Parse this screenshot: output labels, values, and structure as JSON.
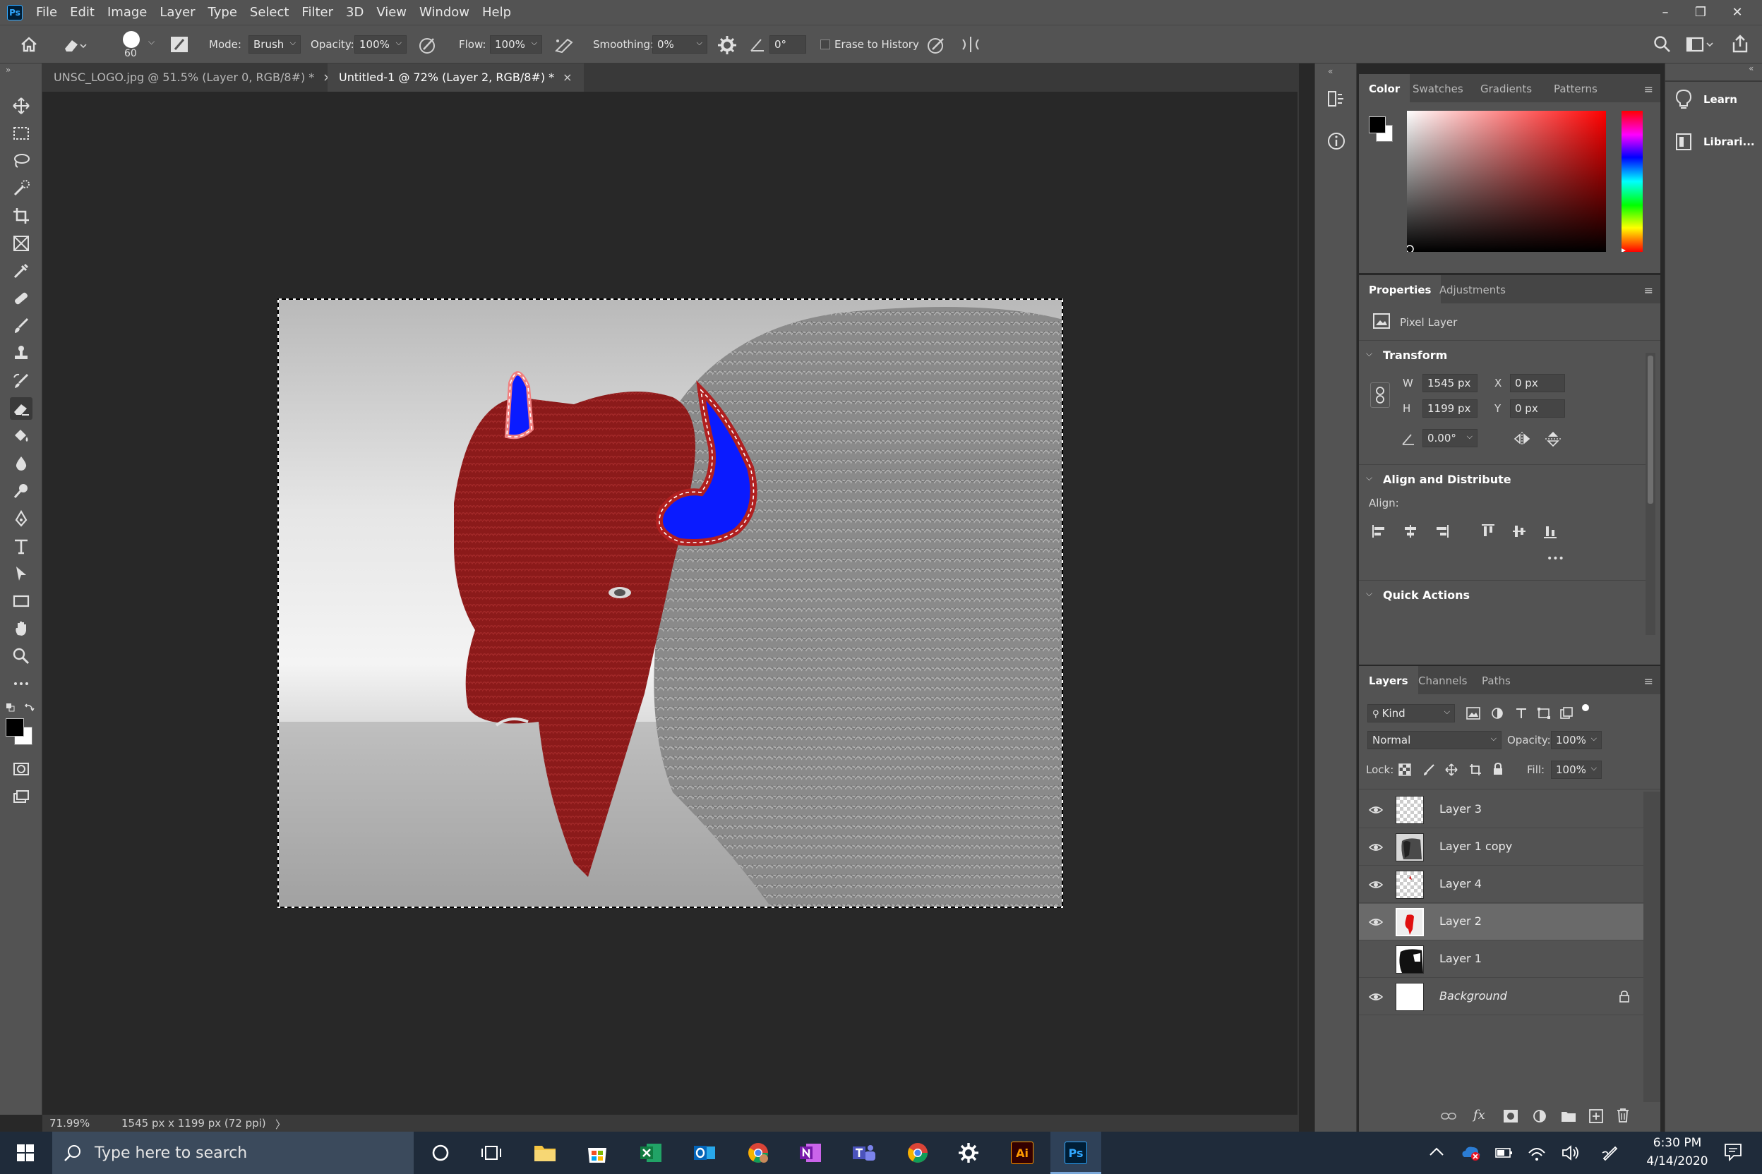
{
  "app": {
    "logo": "Ps"
  },
  "menubar": {
    "items": [
      "File",
      "Edit",
      "Image",
      "Layer",
      "Type",
      "Select",
      "Filter",
      "3D",
      "View",
      "Window",
      "Help"
    ]
  },
  "window_controls": {
    "minimize": "–",
    "restore": "❐",
    "close": "✕"
  },
  "options_bar": {
    "brush_size": "60",
    "mode_label": "Mode:",
    "mode_value": "Brush",
    "opacity_label": "Opacity:",
    "opacity_value": "100%",
    "flow_label": "Flow:",
    "flow_value": "100%",
    "smoothing_label": "Smoothing:",
    "smoothing_value": "0%",
    "angle_value": "0°",
    "erase_history_label": "Erase to History"
  },
  "doc_tabs": [
    {
      "label": "UNSC_LOGO.jpg @ 51.5% (Layer 0, RGB/8#) *",
      "close": "×"
    },
    {
      "label": "Untitled-1 @ 72% (Layer 2, RGB/8#) *",
      "close": "×"
    }
  ],
  "status": {
    "zoom": "71.99%",
    "doc_info": "1545 px x 1199 px (72 ppi)",
    "arrow": "〉"
  },
  "color_panel": {
    "tabs": [
      "Color",
      "Swatches",
      "Gradients",
      "Patterns"
    ]
  },
  "properties_panel": {
    "tabs": [
      "Properties",
      "Adjustments"
    ],
    "layer_kind": "Pixel Layer",
    "transform_title": "Transform",
    "w_label": "W",
    "w_value": "1545 px",
    "h_label": "H",
    "h_value": "1199 px",
    "x_label": "X",
    "x_value": "0 px",
    "y_label": "Y",
    "y_value": "0 px",
    "angle_value": "0.00°",
    "align_title": "Align and Distribute",
    "align_label": "Align:",
    "more": "•••",
    "quick_actions_title": "Quick Actions"
  },
  "layers_panel": {
    "tabs": [
      "Layers",
      "Channels",
      "Paths"
    ],
    "kind_label": "Kind",
    "blend_mode": "Normal",
    "opacity_label": "Opacity:",
    "opacity_value": "100%",
    "lock_label": "Lock:",
    "fill_label": "Fill:",
    "fill_value": "100%",
    "layers": [
      {
        "name": "Layer 3",
        "visible": true
      },
      {
        "name": "Layer 1 copy",
        "visible": true
      },
      {
        "name": "Layer 4",
        "visible": true
      },
      {
        "name": "Layer 2",
        "visible": true,
        "selected": true
      },
      {
        "name": "Layer 1",
        "visible": false
      },
      {
        "name": "Background",
        "visible": true,
        "locked": true
      }
    ]
  },
  "right_strip": {
    "learn_label": "Learn",
    "libraries_label": "Librari..."
  },
  "taskbar": {
    "search_placeholder": "Type here to search",
    "time": "6:30 PM",
    "date": "4/14/2020",
    "ai_label": "Ai",
    "ps_label": "Ps"
  },
  "colors": {
    "accent": "#31a8ff",
    "selection_red": "#8b1a1a",
    "horn_blue": "#0a1bff"
  }
}
